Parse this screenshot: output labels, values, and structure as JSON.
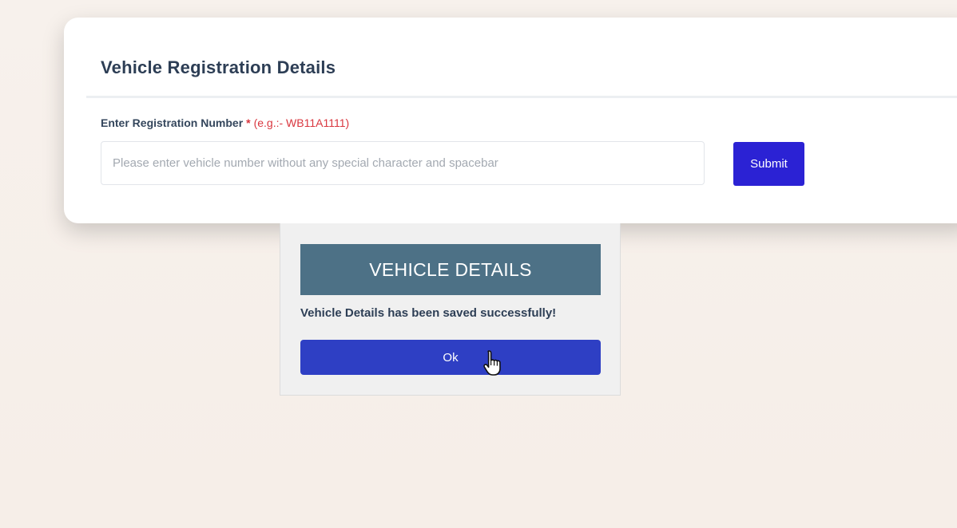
{
  "registration_card": {
    "title": "Vehicle Registration Details",
    "field_label": "Enter Registration Number",
    "required_marker": "*",
    "example_hint": "(e.g.:- WB11A1111)",
    "input_value": "",
    "input_placeholder": "Please enter vehicle number without any special character and spacebar",
    "submit_label": "Submit"
  },
  "modal": {
    "title": "VEHICLE DETAILS",
    "message": "Vehicle Details has been saved successfully!",
    "ok_label": "Ok"
  },
  "colors": {
    "submit_button": "#2b22d4",
    "modal_header": "#4d7186",
    "ok_button": "#2e3fc4",
    "required_text": "#d9363e"
  },
  "icons": {
    "cursor": "hand-pointer-cursor-icon"
  }
}
